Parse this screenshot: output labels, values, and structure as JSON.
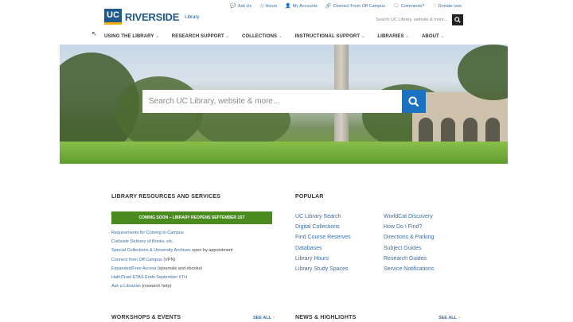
{
  "logo": {
    "uc": "UC",
    "riverside": "RIVERSIDE",
    "library": "Library"
  },
  "utility_nav": [
    {
      "label": "Ask Us",
      "icon": "chat-icon"
    },
    {
      "label": "Hours",
      "icon": "clock-icon"
    },
    {
      "label": "My Accounts",
      "icon": "user-icon"
    },
    {
      "label": "Connect From Off Campus",
      "icon": "link-icon"
    },
    {
      "label": "Comments?",
      "icon": "comment-icon"
    },
    {
      "label": "Donate now",
      "icon": "heart-icon"
    }
  ],
  "header_search": {
    "placeholder": "Search UC Library, website & more..."
  },
  "main_nav": [
    {
      "label": "USING THE LIBRARY"
    },
    {
      "label": "RESEARCH SUPPORT"
    },
    {
      "label": "COLLECTIONS"
    },
    {
      "label": "INSTRUCTIONAL SUPPORT"
    },
    {
      "label": "LIBRARIES"
    },
    {
      "label": "ABOUT"
    }
  ],
  "hero_search": {
    "placeholder": "Search UC Library, website & more..."
  },
  "resources": {
    "title": "LIBRARY RESOURCES AND SERVICES",
    "banner": "COMING SOON – LIBRARY REOPENS SEPTEMBER 1ST",
    "items": [
      {
        "link": "Requirements for Coming to Campus",
        "note": ""
      },
      {
        "link": "Curbside Delivery of Books, etc.",
        "note": ""
      },
      {
        "link": "Special Collections & University Archives",
        "note": " open by appointment"
      },
      {
        "link": "Connect from Off Campus",
        "note": " (VPN)"
      },
      {
        "link": "Expanded/Free Access",
        "note": " (ejournals and ebooks)"
      },
      {
        "link": "HathiTrust ETAS Ends September 6TH",
        "note": ""
      },
      {
        "link": "Ask a Librarian",
        "note": " (research help)"
      }
    ]
  },
  "popular": {
    "title": "POPULAR",
    "col1": [
      "UC Library Search",
      "Digital Collections",
      "Find Course Reserves",
      "Databases",
      "Library Hours",
      "Library Study Spaces"
    ],
    "col2": [
      "WorldCat Discovery",
      "How Do I Find?",
      "Directions & Parking",
      "Subject Guides",
      "Research Guides",
      "Service Notifications"
    ]
  },
  "workshops": {
    "title": "WORKSHOPS & EVENTS",
    "see_all": "SEE ALL"
  },
  "news": {
    "title": "NEWS & HIGHLIGHTS",
    "see_all": "SEE ALL"
  },
  "colors": {
    "brand_blue": "#1f5a8c",
    "link_blue": "#3a6ea5",
    "banner_green": "#4a8a1e",
    "search_button": "#1a72c0",
    "gold": "#f1ab00"
  }
}
